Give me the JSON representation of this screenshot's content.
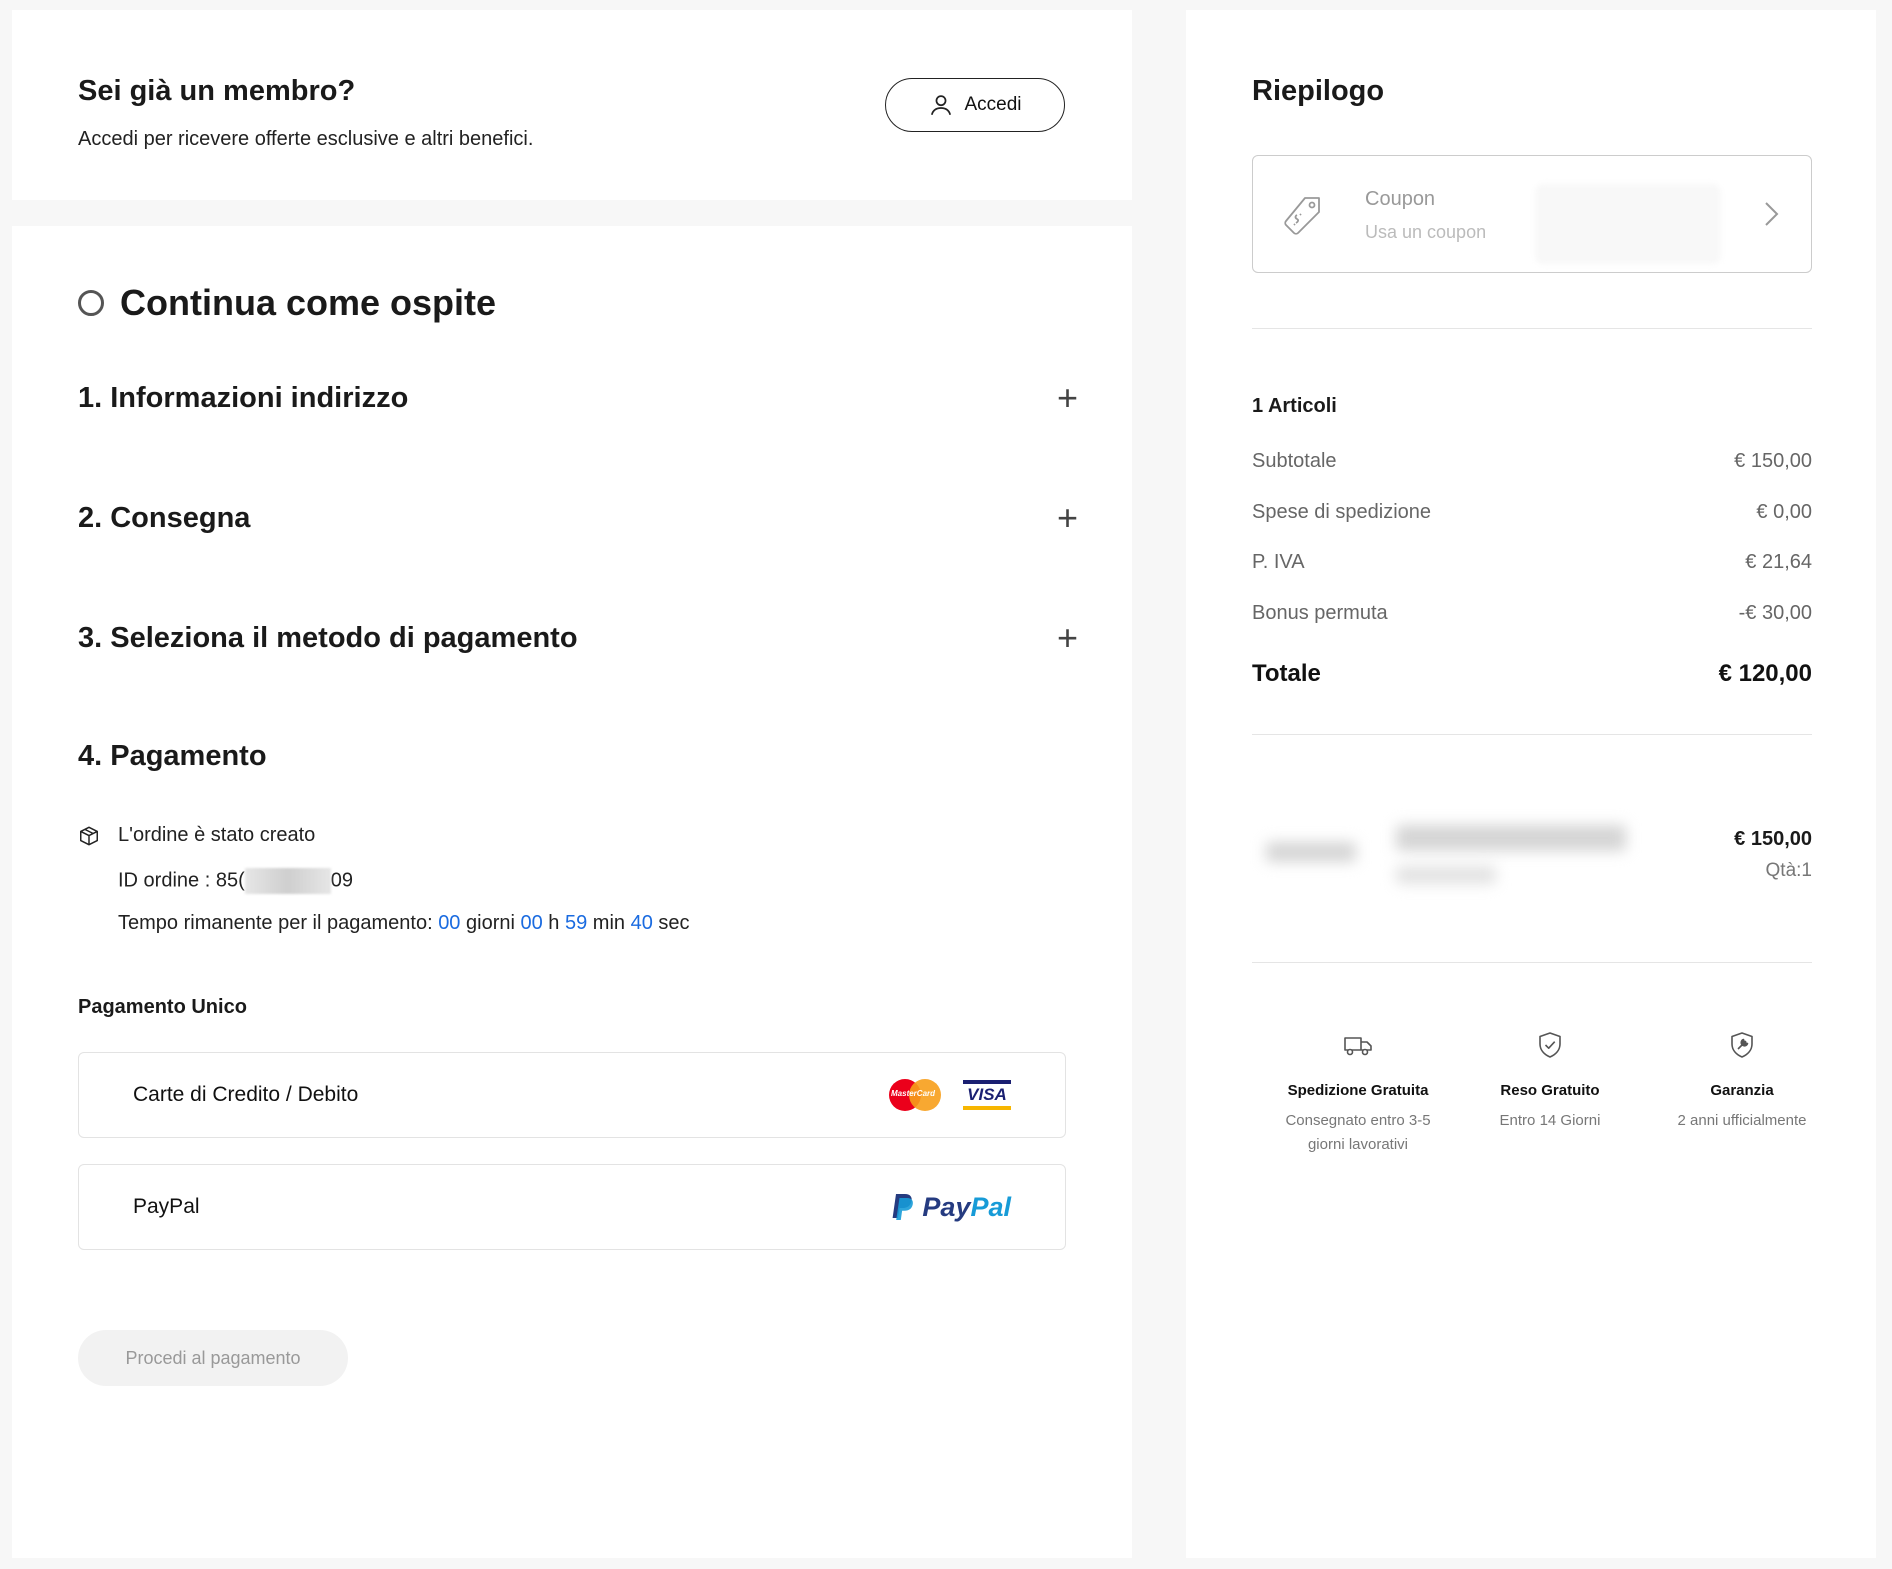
{
  "member": {
    "title": "Sei già un membro?",
    "subtitle": "Accedi per ricevere offerte esclusive e altri benefici.",
    "login_label": "Accedi"
  },
  "checkout": {
    "guest_title": "Continua come ospite",
    "steps": [
      {
        "label": "1. Informazioni indirizzo"
      },
      {
        "label": "2. Consegna"
      },
      {
        "label": "3. Seleziona il metodo di pagamento"
      },
      {
        "label": "4. Pagamento"
      }
    ],
    "order": {
      "created_text": "L'ordine è stato creato",
      "id_label": "ID ordine :",
      "id_prefix": "85(",
      "id_suffix": "09",
      "time_label": "Tempo rimanente per il pagamento:",
      "days": "00",
      "days_unit": "giorni",
      "hours": "00",
      "hours_unit": "h",
      "minutes": "59",
      "minutes_unit": "min",
      "seconds": "40",
      "seconds_unit": "sec"
    },
    "payment_section_title": "Pagamento Unico",
    "payment_options": [
      {
        "label": "Carte di Credito / Debito",
        "logos": [
          "mastercard-logo",
          "visa-logo"
        ]
      },
      {
        "label": "PayPal",
        "logos": [
          "paypal-logo"
        ]
      }
    ],
    "mastercard_text": "MasterCard",
    "visa_text": "VISA",
    "paypal_text_pay": "Pay",
    "paypal_text_pal": "Pal",
    "proceed_label": "Procedi al pagamento"
  },
  "summary": {
    "title": "Riepilogo",
    "coupon": {
      "title": "Coupon",
      "subtitle": "Usa un coupon"
    },
    "articles": "1 Articoli",
    "rows": [
      {
        "label": "Subtotale",
        "value": "€ 150,00"
      },
      {
        "label": "Spese di spedizione",
        "value": "€ 0,00"
      },
      {
        "label": "P. IVA",
        "value": "€ 21,64"
      },
      {
        "label": "Bonus permuta",
        "value": "-€ 30,00"
      }
    ],
    "total": {
      "label": "Totale",
      "value": "€ 120,00"
    },
    "product": {
      "price": "€ 150,00",
      "qty": "Qtà:1"
    },
    "features": [
      {
        "icon": "truck-icon",
        "title": "Spedizione Gratuita",
        "desc": "Consegnato entro 3-5 giorni lavorativi"
      },
      {
        "icon": "shield-check-icon",
        "title": "Reso Gratuito",
        "desc": "Entro 14 Giorni"
      },
      {
        "icon": "shield-wrench-icon",
        "title": "Garanzia",
        "desc": "2 anni ufficialmente"
      }
    ]
  },
  "colors": {
    "accent_blue": "#1a6be0",
    "background": "#f7f7f7",
    "panel": "#ffffff"
  }
}
